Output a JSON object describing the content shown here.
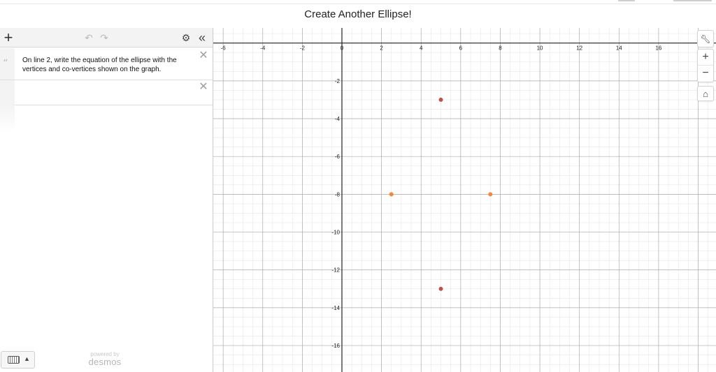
{
  "header": {
    "title": "Create Another Ellipse!"
  },
  "toolbar": {
    "add_icon": "+",
    "undo_icon": "↶",
    "redo_icon": "↷",
    "settings_icon": "⚙",
    "collapse_icon": "«"
  },
  "expressions": [
    {
      "type": "note",
      "number": "1",
      "text": "On line 2, write the equation of the ellipse with the vertices and co-vertices shown on the graph.",
      "delete_icon": "✕"
    },
    {
      "type": "expression",
      "number": "2",
      "text": "",
      "delete_icon": "✕"
    }
  ],
  "footer": {
    "powered_by": "powered by",
    "brand": "desmos",
    "keyboard_arrow": "▲"
  },
  "graph_controls": {
    "wrench_icon": "🔧",
    "zoom_in": "+",
    "zoom_out": "−",
    "home_icon": "⌂"
  },
  "graph": {
    "x_range": [
      -6.5,
      18.9
    ],
    "y_range": [
      -17.4,
      0.8
    ],
    "x_ticks": [
      -6,
      -4,
      -2,
      0,
      2,
      4,
      6,
      8,
      10,
      12,
      14,
      16
    ],
    "y_ticks": [
      -2,
      -4,
      -6,
      -8,
      -10,
      -12,
      -14,
      -16
    ],
    "points": [
      {
        "x": 5,
        "y": -3,
        "color": "#c0504d"
      },
      {
        "x": 5,
        "y": -13,
        "color": "#c0504d"
      },
      {
        "x": 2.5,
        "y": -8,
        "color": "#f2883a"
      },
      {
        "x": 7.5,
        "y": -8,
        "color": "#f2883a"
      }
    ]
  }
}
